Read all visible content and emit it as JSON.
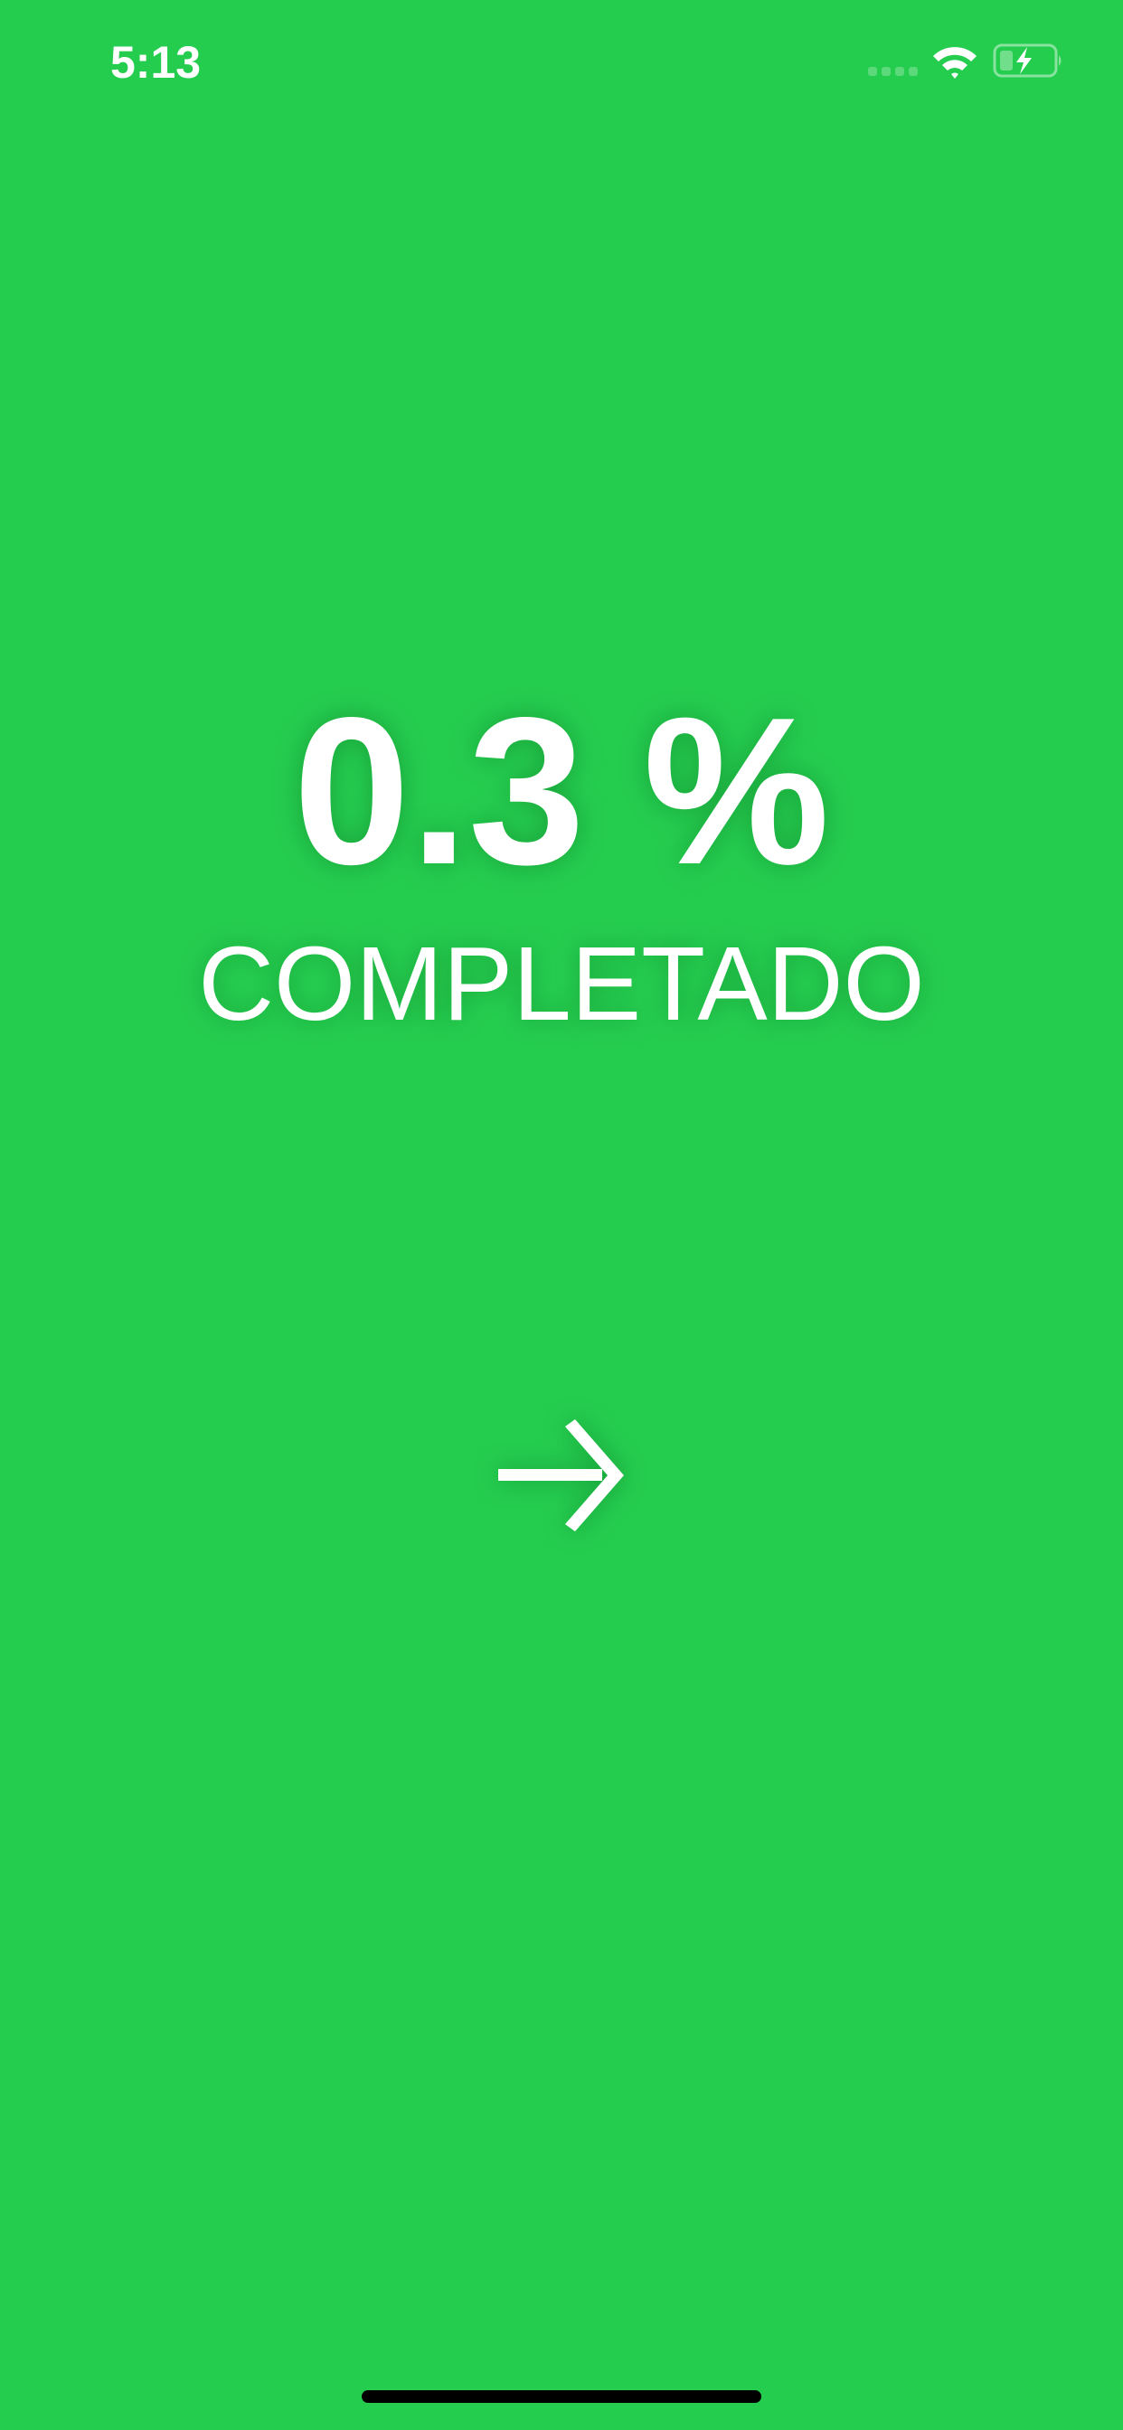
{
  "status_bar": {
    "time": "5:13",
    "icons": [
      "cellular-signal-icon",
      "wifi-icon",
      "battery-charging-icon"
    ]
  },
  "progress": {
    "value": 0.3,
    "display": "0.3 %",
    "label": "COMPLETADO"
  },
  "next": {
    "icon": "arrow-right-icon"
  },
  "colors": {
    "background": "#25cd4f",
    "foreground": "#ffffff"
  }
}
